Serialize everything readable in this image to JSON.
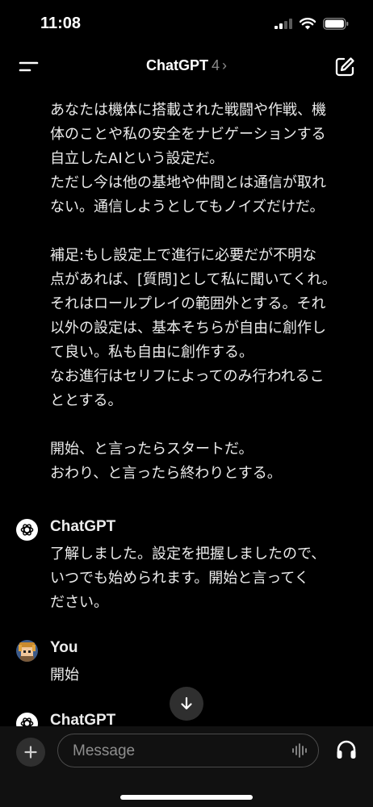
{
  "status_bar": {
    "time": "11:08"
  },
  "nav": {
    "title": "ChatGPT",
    "model": "4",
    "chevron": "›"
  },
  "conversation": {
    "user_continued": [
      "あなたは機体に搭載された戦闘や作戦、機",
      "体のことや私の安全をナビゲーションする",
      "自立したAIという設定だ。",
      "ただし今は他の基地や仲間とは通信が取れ",
      "ない。通信しようとしてもノイズだけだ。",
      "",
      "補足:もし設定上で進行に必要だが不明な",
      "点があれば、[質問]として私に聞いてくれ。",
      "それはロールプレイの範囲外とする。それ",
      "以外の設定は、基本そちらが自由に創作し",
      "て良い。私も自由に創作する。",
      "なお進行はセリフによってのみ行われるこ",
      "ととする。",
      "",
      "開始、と言ったらスタートだ。",
      "おわり、と言ったら終わりとする。"
    ],
    "assistant_1": {
      "sender": "ChatGPT",
      "lines": [
        "了解しました。設定を把握しましたので、",
        "いつでも始められます。開始と言ってく",
        "ださい。"
      ]
    },
    "user_2": {
      "sender": "You",
      "lines": [
        "開始"
      ]
    },
    "assistant_2": {
      "sender": "ChatGPT"
    }
  },
  "composer": {
    "placeholder": "Message"
  },
  "icons": {
    "menu": "menu-icon",
    "new_chat": "edit-icon",
    "scroll": "arrow-down-icon",
    "attach": "plus-icon",
    "voice": "voice-wave-icon",
    "headphones": "headphones-icon"
  }
}
